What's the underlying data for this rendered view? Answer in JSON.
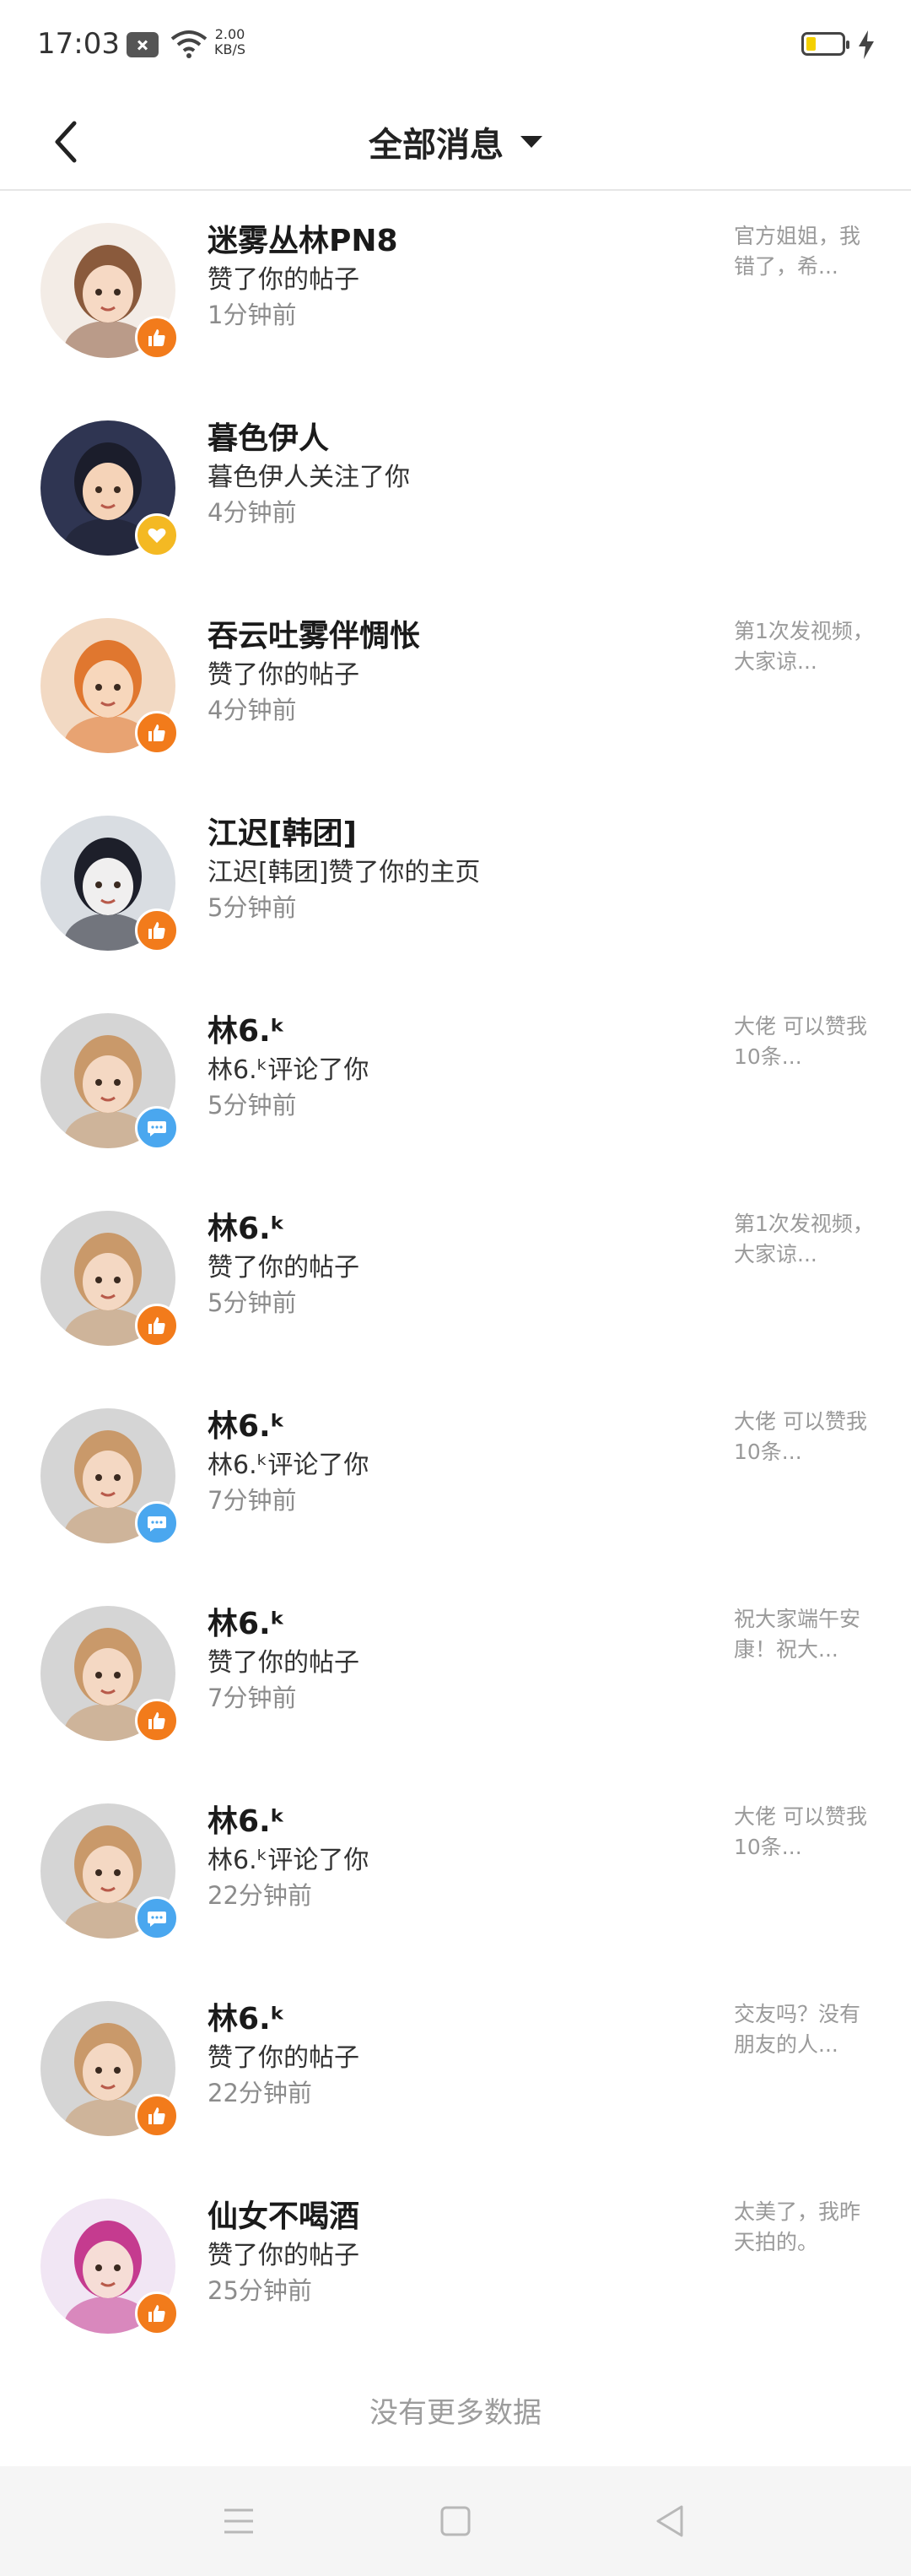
{
  "status_bar": {
    "time": "17:03",
    "net_speed_value": "2.00",
    "net_speed_unit": "KB/S",
    "battery_color": "#f4d000"
  },
  "header": {
    "title": "全部消息",
    "back_icon": "chevron-left-icon",
    "dropdown_icon": "caret-down-icon"
  },
  "colors": {
    "like_badge": "#f27b1b",
    "follow_badge": "#f4b923",
    "comment_badge": "#4aa7ef"
  },
  "messages": [
    {
      "name": "迷雾丛林PN8",
      "action": "赞了你的帖子",
      "time": "1分钟前",
      "preview": "官方姐姐，我错了，希...",
      "badge": "like"
    },
    {
      "name": "暮色伊人",
      "action": "暮色伊人关注了你",
      "time": "4分钟前",
      "preview": "",
      "badge": "follow"
    },
    {
      "name": "吞云吐雾伴惆怅",
      "action": "赞了你的帖子",
      "time": "4分钟前",
      "preview": "第1次发视频，大家谅...",
      "badge": "like"
    },
    {
      "name": "江迟[韩团]",
      "action": "江迟[韩团]赞了你的主页",
      "time": "5分钟前",
      "preview": "",
      "badge": "like"
    },
    {
      "name": "林6.ᵏ",
      "action": "林6.ᵏ评论了你",
      "time": "5分钟前",
      "preview": "大佬 可以赞我10条...",
      "badge": "comment"
    },
    {
      "name": "林6.ᵏ",
      "action": "赞了你的帖子",
      "time": "5分钟前",
      "preview": "第1次发视频，大家谅...",
      "badge": "like"
    },
    {
      "name": "林6.ᵏ",
      "action": "林6.ᵏ评论了你",
      "time": "7分钟前",
      "preview": "大佬 可以赞我10条...",
      "badge": "comment"
    },
    {
      "name": "林6.ᵏ",
      "action": "赞了你的帖子",
      "time": "7分钟前",
      "preview": "祝大家端午安康！祝大...",
      "badge": "like"
    },
    {
      "name": "林6.ᵏ",
      "action": "林6.ᵏ评论了你",
      "time": "22分钟前",
      "preview": "大佬 可以赞我10条...",
      "badge": "comment"
    },
    {
      "name": "林6.ᵏ",
      "action": "赞了你的帖子",
      "time": "22分钟前",
      "preview": "交友吗？没有朋友的人...",
      "badge": "like"
    },
    {
      "name": "仙女不喝酒",
      "action": "赞了你的帖子",
      "time": "25分钟前",
      "preview": "太美了，我昨天拍的。",
      "badge": "like"
    }
  ],
  "footer": {
    "no_more": "没有更多数据"
  },
  "nav_bar": {
    "menu_icon": "menu-icon",
    "home_icon": "square-home-icon",
    "back_icon": "triangle-back-icon"
  }
}
